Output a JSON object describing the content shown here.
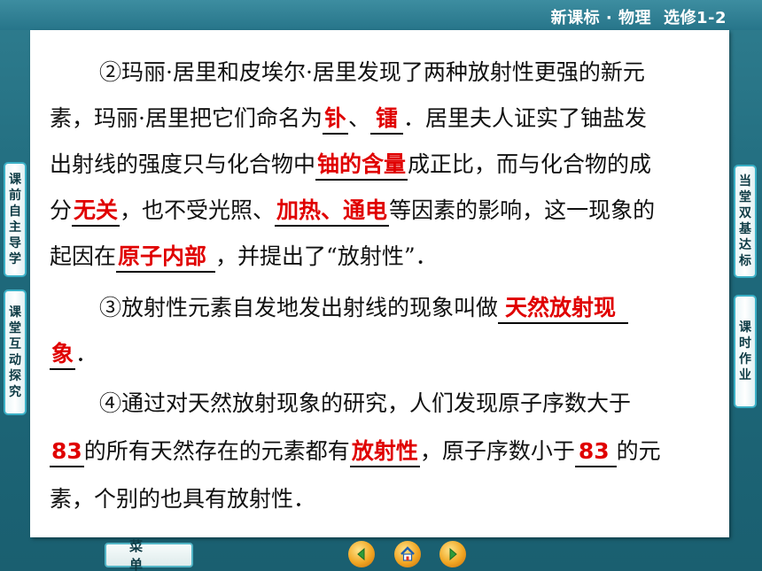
{
  "header": {
    "course": "新课标 · 物理",
    "module": "选修1-2"
  },
  "left_nav": [
    {
      "label": "课前自主导学"
    },
    {
      "label": "课堂互动探究"
    }
  ],
  "right_nav": [
    {
      "label": "当堂双基达标"
    },
    {
      "label": "课时作业"
    }
  ],
  "content": {
    "p2": {
      "l1": "②玛丽·居里和皮埃尔·居里发现了两种放射性更强的新元",
      "l2a": "素，玛丽·居里把它们命名为",
      "ans_polonium": "钋",
      "l2b": "、",
      "ans_radium": "镭",
      "l2c": "．居里夫人证实了铀盐发",
      "l3a": "出射线的强度只与化合物中",
      "ans_uranium": "铀的含量",
      "l3b": "成正比，而与化合物的成",
      "l4a": "分",
      "ans_unrelated": "无关",
      "l4b": "，也不受光照、",
      "ans_heat": "加热、通电",
      "l4c": "等因素的影响，这一现象的",
      "l5a": "起因在",
      "ans_origin": "原子内部",
      "l5b": "，并提出了“放射性”．"
    },
    "p3": {
      "l1a": "③放射性元素自发地发出射线的现象叫做",
      "ans1": "天然放射现",
      "ans2": "象",
      "l2b": "．"
    },
    "p4": {
      "l1": "④通过对天然放射现象的研究，人们发现原子序数大于",
      "ans_83a": "83",
      "l2a": "的所有天然存在的元素都有",
      "ans_radio": "放射性",
      "l2b": "，原子序数小于",
      "ans_83b": "83",
      "l2c": "的元",
      "l3": "素，个别的也具有放射性．"
    }
  },
  "footer": {
    "menu_label": "菜单"
  },
  "icons": [
    "back-icon",
    "home-icon",
    "forward-icon"
  ],
  "colors": {
    "answer": "#e00000",
    "accent": "#3ab0c6"
  }
}
